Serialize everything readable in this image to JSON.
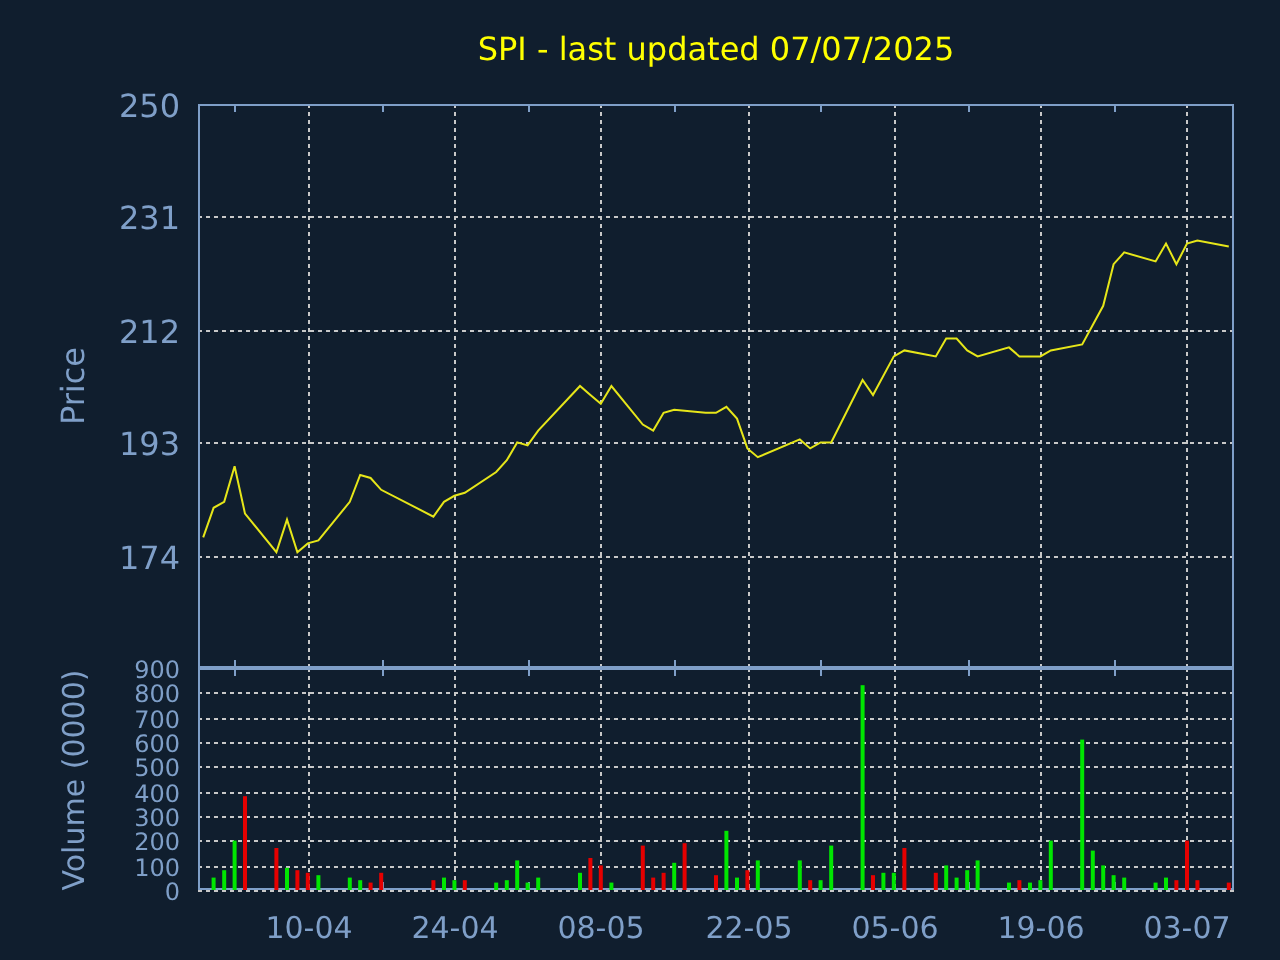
{
  "title": "SPI - last updated 07/07/2025",
  "price_chart": {
    "chart_data": {
      "type": "line",
      "ylabel": "Price",
      "grid": true,
      "ylim": [
        155,
        250
      ],
      "yticks": [
        174,
        193,
        212,
        231,
        250
      ],
      "series": [
        {
          "color": "#e6e619",
          "values": [
            177,
            182,
            183,
            189,
            181,
            null,
            null,
            174.5,
            180,
            174.5,
            176,
            176.5,
            null,
            null,
            183,
            187.5,
            187,
            185,
            null,
            null,
            null,
            null,
            180.5,
            183,
            184,
            184.5,
            null,
            null,
            188,
            190,
            193,
            192.5,
            195,
            null,
            null,
            null,
            202.5,
            201,
            199.5,
            202.5,
            null,
            null,
            196,
            195,
            198,
            198.5,
            null,
            null,
            198,
            198,
            199,
            197,
            192,
            190.5,
            null,
            null,
            null,
            193.5,
            192,
            193,
            193,
            null,
            null,
            203.5,
            201,
            null,
            207.5,
            208.5,
            null,
            null,
            207.5,
            210.5,
            210.5,
            208.5,
            207.5,
            null,
            null,
            209,
            207.5,
            null,
            207.5,
            208.5,
            null,
            null,
            209.5,
            null,
            216,
            223,
            225,
            null,
            null,
            223.5,
            226.5,
            223,
            226.5,
            227,
            null,
            null,
            226
          ]
        }
      ]
    }
  },
  "volume_chart": {
    "chart_data": {
      "type": "bar",
      "ylabel": "Volume (0000)",
      "grid": true,
      "ylim": [
        0,
        900
      ],
      "yticks": [
        0,
        100,
        200,
        300,
        400,
        500,
        600,
        700,
        800,
        900
      ],
      "categories": [
        null,
        null,
        null,
        null,
        null,
        null,
        null,
        null,
        null,
        null,
        "10-04",
        null,
        null,
        null,
        null,
        null,
        null,
        null,
        null,
        null,
        null,
        null,
        null,
        null,
        "24-04",
        null,
        null,
        null,
        null,
        null,
        null,
        null,
        null,
        null,
        null,
        null,
        null,
        null,
        "08-05",
        null,
        null,
        null,
        null,
        null,
        null,
        null,
        null,
        null,
        null,
        null,
        null,
        null,
        "22-05",
        null,
        null,
        null,
        null,
        null,
        null,
        null,
        null,
        null,
        null,
        null,
        null,
        null,
        "05-06",
        null,
        null,
        null,
        null,
        null,
        null,
        null,
        null,
        null,
        null,
        null,
        null,
        null,
        "19-06",
        null,
        null,
        null,
        null,
        null,
        null,
        null,
        null,
        null,
        null,
        null,
        null,
        null,
        "03-07",
        null,
        null,
        null,
        null
      ],
      "series": [
        {
          "color": "#00e600",
          "values": [
            null,
            50,
            80,
            200,
            null,
            null,
            null,
            null,
            90,
            null,
            null,
            60,
            null,
            null,
            50,
            40,
            null,
            null,
            null,
            null,
            null,
            null,
            null,
            50,
            40,
            null,
            null,
            null,
            30,
            40,
            120,
            30,
            50,
            null,
            null,
            null,
            70,
            null,
            null,
            30,
            null,
            null,
            null,
            null,
            null,
            110,
            null,
            null,
            null,
            null,
            240,
            50,
            null,
            120,
            null,
            null,
            null,
            120,
            null,
            40,
            180,
            null,
            null,
            830,
            null,
            70,
            70,
            null,
            null,
            null,
            null,
            100,
            50,
            80,
            120,
            null,
            null,
            30,
            null,
            30,
            40,
            200,
            null,
            null,
            610,
            160,
            100,
            60,
            50,
            null,
            null,
            30,
            50,
            null,
            null,
            null,
            null,
            null,
            null
          ]
        },
        {
          "color": "#e60000",
          "values": [
            null,
            null,
            null,
            null,
            380,
            null,
            null,
            170,
            null,
            80,
            70,
            null,
            null,
            null,
            null,
            null,
            30,
            70,
            null,
            null,
            null,
            null,
            40,
            null,
            null,
            40,
            null,
            null,
            null,
            null,
            null,
            null,
            null,
            null,
            null,
            null,
            null,
            130,
            100,
            null,
            null,
            null,
            180,
            50,
            70,
            null,
            190,
            null,
            null,
            60,
            null,
            null,
            80,
            null,
            null,
            null,
            null,
            null,
            40,
            null,
            null,
            null,
            null,
            null,
            60,
            null,
            null,
            170,
            null,
            null,
            70,
            null,
            null,
            null,
            null,
            null,
            null,
            null,
            40,
            null,
            null,
            null,
            null,
            null,
            null,
            null,
            null,
            null,
            null,
            null,
            null,
            null,
            null,
            40,
            200,
            40,
            null,
            null,
            30
          ]
        }
      ]
    }
  }
}
